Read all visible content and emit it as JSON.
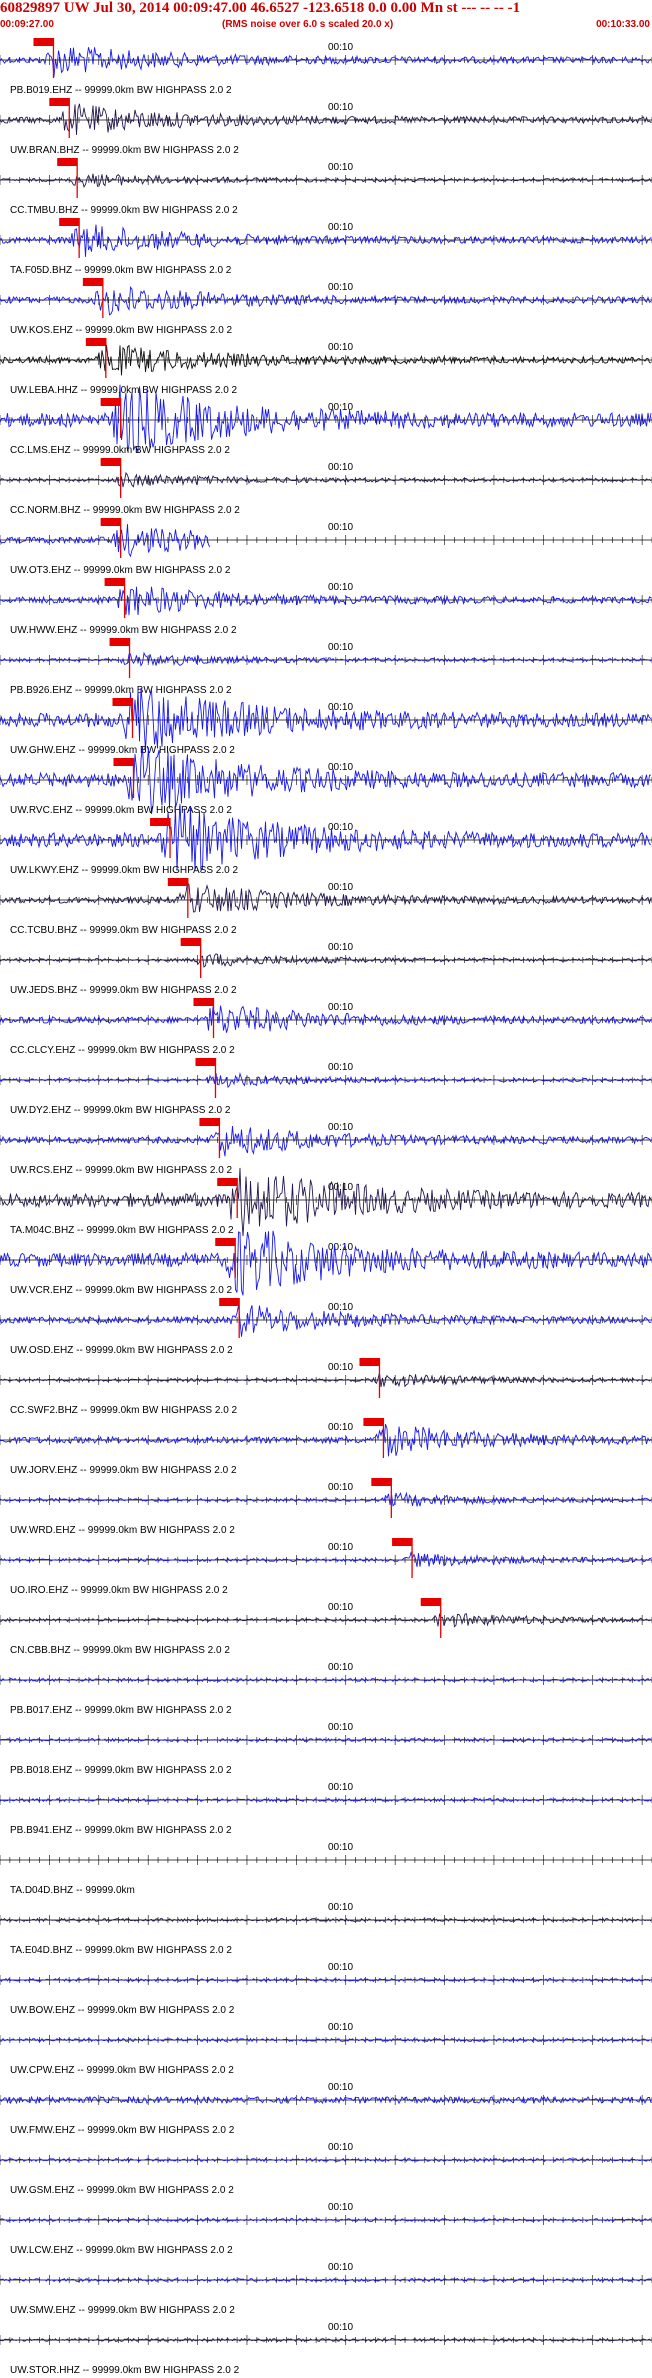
{
  "header": {
    "title": "60829897 UW Jul 30, 2014 00:09:47.00   46.6527 -123.6518  0.0 0.00 Mn st --- -- --  -1",
    "start_time": "00:09:27.00",
    "note": "(RMS noise over 6.0 s scaled 20.0 x)",
    "end_time": "00:10:33.00"
  },
  "time_tick_label": "00:10",
  "colors": {
    "blue": "#1a1aee",
    "navy": "#26194f",
    "black": "#111111",
    "pick": "#e60000"
  },
  "traces": [
    {
      "label": "PB.B019.EHZ -- 99999.0km BW  HIGHPASS  2.0  2",
      "color": "blue",
      "pick_sec": 4.4,
      "amp": "med"
    },
    {
      "label": "UW.BRAN.BHZ -- 99999.0km BW  HIGHPASS  2.0  2",
      "color": "navy",
      "pick_sec": 6.0,
      "amp": "med"
    },
    {
      "label": "CC.TMBU.BHZ -- 99999.0km BW  HIGHPASS  2.0  2",
      "color": "navy",
      "pick_sec": 6.8,
      "amp": "low"
    },
    {
      "label": "TA.F05D.BHZ -- 99999.0km BW  HIGHPASS  2.0  2",
      "color": "blue",
      "pick_sec": 7.0,
      "amp": "med"
    },
    {
      "label": "UW.KOS.EHZ -- 99999.0km BW  HIGHPASS  2.0  2",
      "color": "blue",
      "pick_sec": 9.4,
      "amp": "med"
    },
    {
      "label": "UW.LEBA.HHZ -- 99999.0km BW  HIGHPASS  2.0  2",
      "color": "black",
      "pick_sec": 9.7,
      "amp": "med"
    },
    {
      "label": "CC.LMS.EHZ -- 99999.0km BW  HIGHPASS  2.0  2",
      "color": "blue",
      "pick_sec": 11.2,
      "amp": "high"
    },
    {
      "label": "CC.NORM.BHZ -- 99999.0km BW  HIGHPASS  2.0  2",
      "color": "navy",
      "pick_sec": 11.2,
      "amp": "low"
    },
    {
      "label": "UW.OT3.EHZ -- 99999.0km BW  HIGHPASS  2.0  2",
      "color": "blue",
      "pick_sec": 11.2,
      "amp": "med"
    },
    {
      "label": "UW.HWW.EHZ -- 99999.0km BW  HIGHPASS  2.0  2",
      "color": "blue",
      "pick_sec": 11.6,
      "amp": "med"
    },
    {
      "label": "PB.B926.EHZ -- 99999.0km BW  HIGHPASS  2.0  2",
      "color": "blue",
      "pick_sec": 12.1,
      "amp": "low"
    },
    {
      "label": "UW.GHW.EHZ -- 99999.0km BW  HIGHPASS  2.0  2",
      "color": "blue",
      "pick_sec": 12.4,
      "amp": "high"
    },
    {
      "label": "UW.RVC.EHZ -- 99999.0km BW  HIGHPASS  2.0  2",
      "color": "blue",
      "pick_sec": 12.5,
      "amp": "high"
    },
    {
      "label": "UW.LKWY.EHZ -- 99999.0km BW  HIGHPASS  2.0  2",
      "color": "blue",
      "pick_sec": 16.2,
      "amp": "high"
    },
    {
      "label": "CC.TCBU.BHZ -- 99999.0km BW  HIGHPASS  2.0  2",
      "color": "navy",
      "pick_sec": 18.0,
      "amp": "med"
    },
    {
      "label": "UW.JEDS.BHZ -- 99999.0km BW  HIGHPASS  2.0  2",
      "color": "navy",
      "pick_sec": 19.3,
      "amp": "low"
    },
    {
      "label": "CC.CLCY.EHZ -- 99999.0km BW  HIGHPASS  2.0  2",
      "color": "blue",
      "pick_sec": 20.6,
      "amp": "med"
    },
    {
      "label": "UW.DY2.EHZ -- 99999.0km BW  HIGHPASS  2.0  2",
      "color": "blue",
      "pick_sec": 20.8,
      "amp": "low"
    },
    {
      "label": "UW.RCS.EHZ -- 99999.0km BW  HIGHPASS  2.0  2",
      "color": "blue",
      "pick_sec": 21.2,
      "amp": "med"
    },
    {
      "label": "TA.M04C.BHZ -- 99999.0km BW  HIGHPASS  2.0  2",
      "color": "navy",
      "pick_sec": 23.0,
      "amp": "high"
    },
    {
      "label": "UW.VCR.EHZ -- 99999.0km BW  HIGHPASS  2.0  2",
      "color": "blue",
      "pick_sec": 22.8,
      "amp": "high"
    },
    {
      "label": "UW.OSD.EHZ -- 99999.0km BW  HIGHPASS  2.0  2",
      "color": "blue",
      "pick_sec": 23.2,
      "amp": "med"
    },
    {
      "label": "CC.SWF2.BHZ -- 99999.0km BW  HIGHPASS  2.0  2",
      "color": "navy",
      "pick_sec": 37.4,
      "amp": "low"
    },
    {
      "label": "UW.JORV.EHZ -- 99999.0km BW  HIGHPASS  2.0  2",
      "color": "blue",
      "pick_sec": 37.8,
      "amp": "med"
    },
    {
      "label": "UW.WRD.EHZ -- 99999.0km BW  HIGHPASS  2.0  2",
      "color": "blue",
      "pick_sec": 38.6,
      "amp": "low"
    },
    {
      "label": "UO.IRO.EHZ -- 99999.0km BW  HIGHPASS  2.0  2",
      "color": "blue",
      "pick_sec": 40.7,
      "amp": "low"
    },
    {
      "label": "CN.CBB.BHZ -- 99999.0km BW  HIGHPASS  2.0  2",
      "color": "navy",
      "pick_sec": 43.6,
      "amp": "low"
    },
    {
      "label": "PB.B017.EHZ -- 99999.0km BW  HIGHPASS  2.0  2",
      "color": "blue",
      "pick_sec": null,
      "amp": "low"
    },
    {
      "label": "PB.B018.EHZ -- 99999.0km BW  HIGHPASS  2.0  2",
      "color": "blue",
      "pick_sec": null,
      "amp": "low"
    },
    {
      "label": "PB.B941.EHZ -- 99999.0km BW  HIGHPASS  2.0  2",
      "color": "blue",
      "pick_sec": null,
      "amp": "low"
    },
    {
      "label": "TA.D04D.BHZ -- 99999.0km",
      "color": "blue",
      "pick_sec": null,
      "amp": "none"
    },
    {
      "label": "TA.E04D.BHZ -- 99999.0km BW  HIGHPASS  2.0  2",
      "color": "navy",
      "pick_sec": null,
      "amp": "low"
    },
    {
      "label": "UW.BOW.EHZ -- 99999.0km BW  HIGHPASS  2.0  2",
      "color": "blue",
      "pick_sec": null,
      "amp": "low"
    },
    {
      "label": "UW.CPW.EHZ -- 99999.0km BW  HIGHPASS  2.0  2",
      "color": "blue",
      "pick_sec": null,
      "amp": "low"
    },
    {
      "label": "UW.FMW.EHZ -- 99999.0km BW  HIGHPASS  2.0  2",
      "color": "blue",
      "pick_sec": null,
      "amp": "med"
    },
    {
      "label": "UW.GSM.EHZ -- 99999.0km BW  HIGHPASS  2.0  2",
      "color": "blue",
      "pick_sec": null,
      "amp": "low"
    },
    {
      "label": "UW.LCW.EHZ -- 99999.0km BW  HIGHPASS  2.0  2",
      "color": "blue",
      "pick_sec": null,
      "amp": "low"
    },
    {
      "label": "UW.SMW.EHZ -- 99999.0km BW  HIGHPASS  2.0  2",
      "color": "blue",
      "pick_sec": null,
      "amp": "low"
    },
    {
      "label": "UW.STOR.HHZ -- 99999.0km BW  HIGHPASS  2.0  2",
      "color": "navy",
      "pick_sec": null,
      "amp": "low"
    }
  ]
}
